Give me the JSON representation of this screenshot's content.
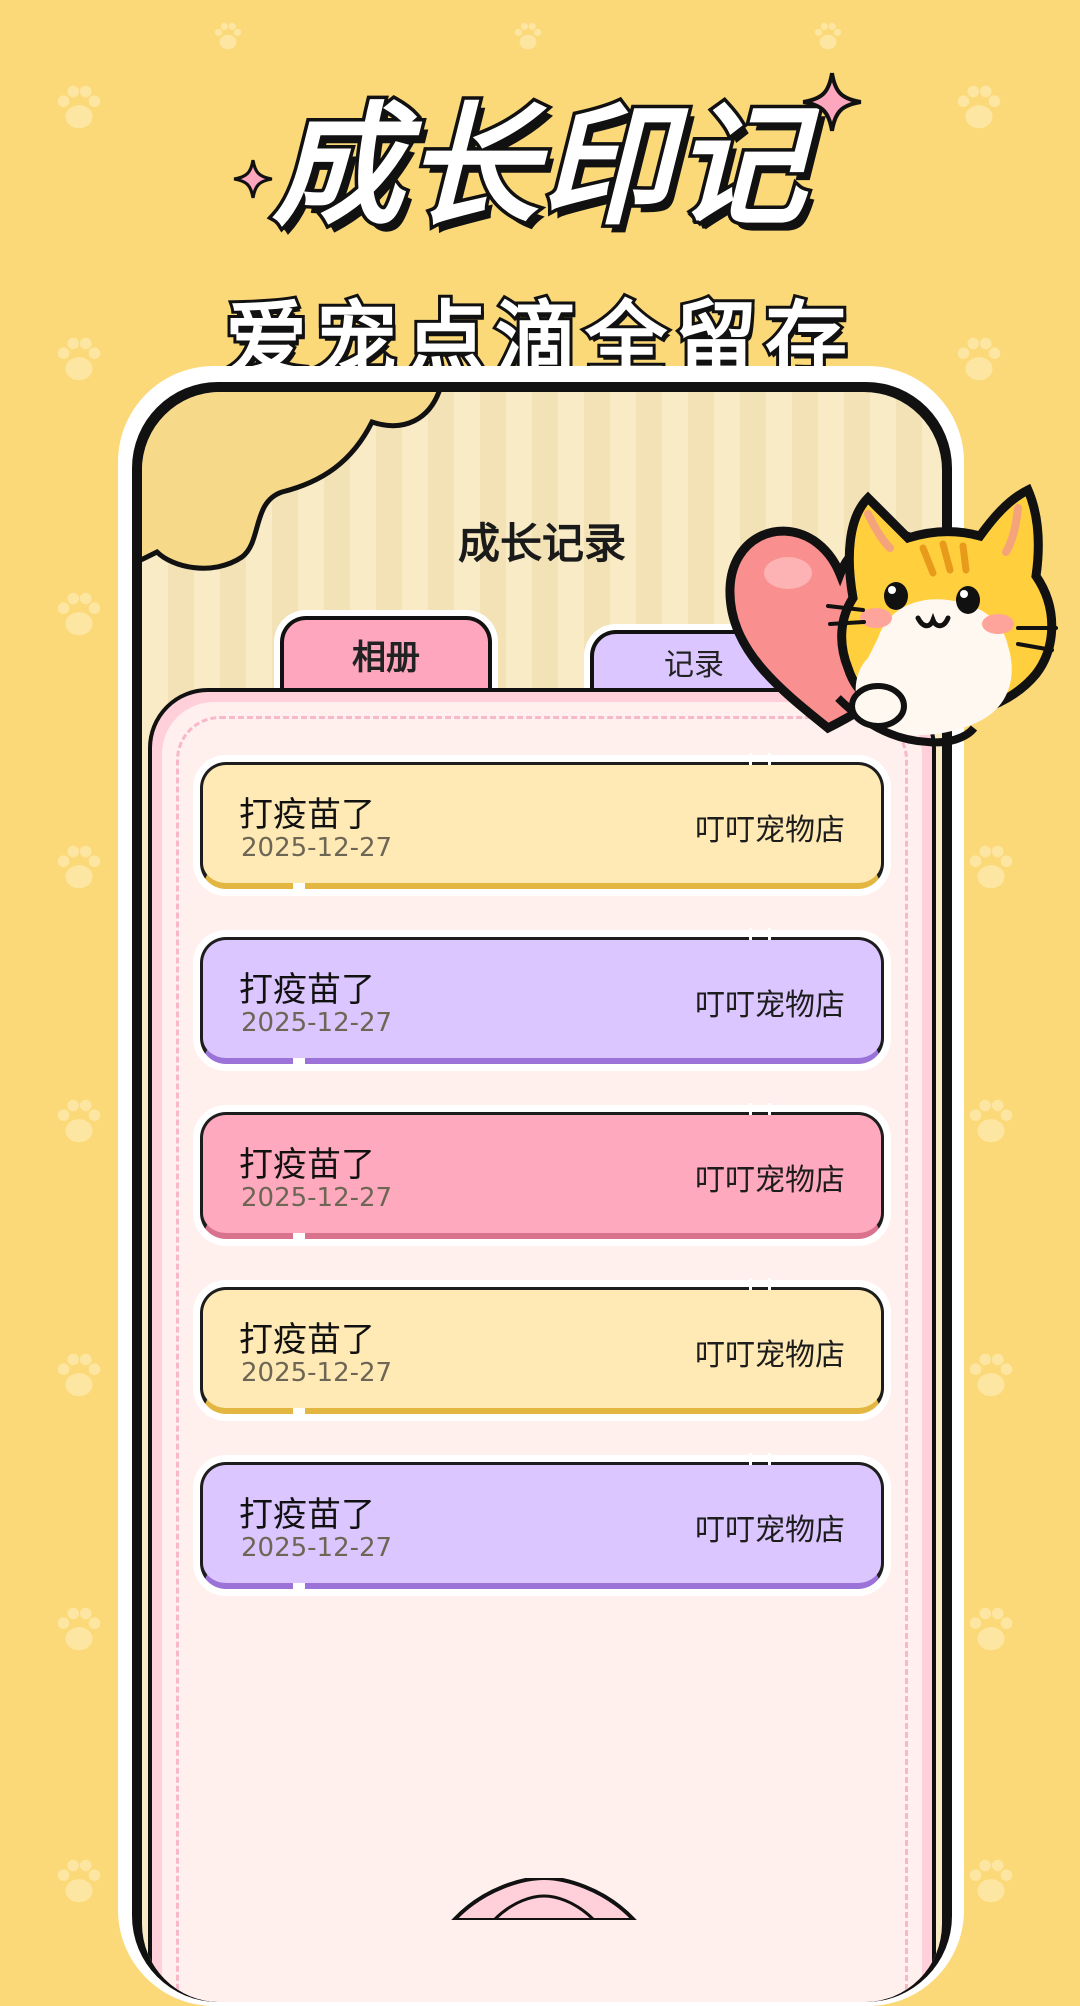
{
  "promo": {
    "title": "成长印记",
    "subtitle": "爱宠点滴全留存"
  },
  "screen": {
    "title": "成长记录",
    "tabs": [
      {
        "label": "相册",
        "active": true
      },
      {
        "label": "记录",
        "active": false
      }
    ]
  },
  "records": [
    {
      "name": "打疫苗了",
      "date": "2025-12-27",
      "shop": "叮叮宠物店",
      "color": "yellow"
    },
    {
      "name": "打疫苗了",
      "date": "2025-12-27",
      "shop": "叮叮宠物店",
      "color": "purple"
    },
    {
      "name": "打疫苗了",
      "date": "2025-12-27",
      "shop": "叮叮宠物店",
      "color": "pink"
    },
    {
      "name": "打疫苗了",
      "date": "2025-12-27",
      "shop": "叮叮宠物店",
      "color": "yellow"
    },
    {
      "name": "打疫苗了",
      "date": "2025-12-27",
      "shop": "叮叮宠物店",
      "color": "purple"
    }
  ],
  "colors": {
    "background": "#fbd878",
    "yellow": "#ffeab5",
    "purple": "#dcc6ff",
    "pink": "#ffa9be",
    "panel": "#fff0ee"
  },
  "icons": [
    "paw-icon",
    "sparkle-icon",
    "cat-heart-mascot",
    "cloud-decoration"
  ]
}
